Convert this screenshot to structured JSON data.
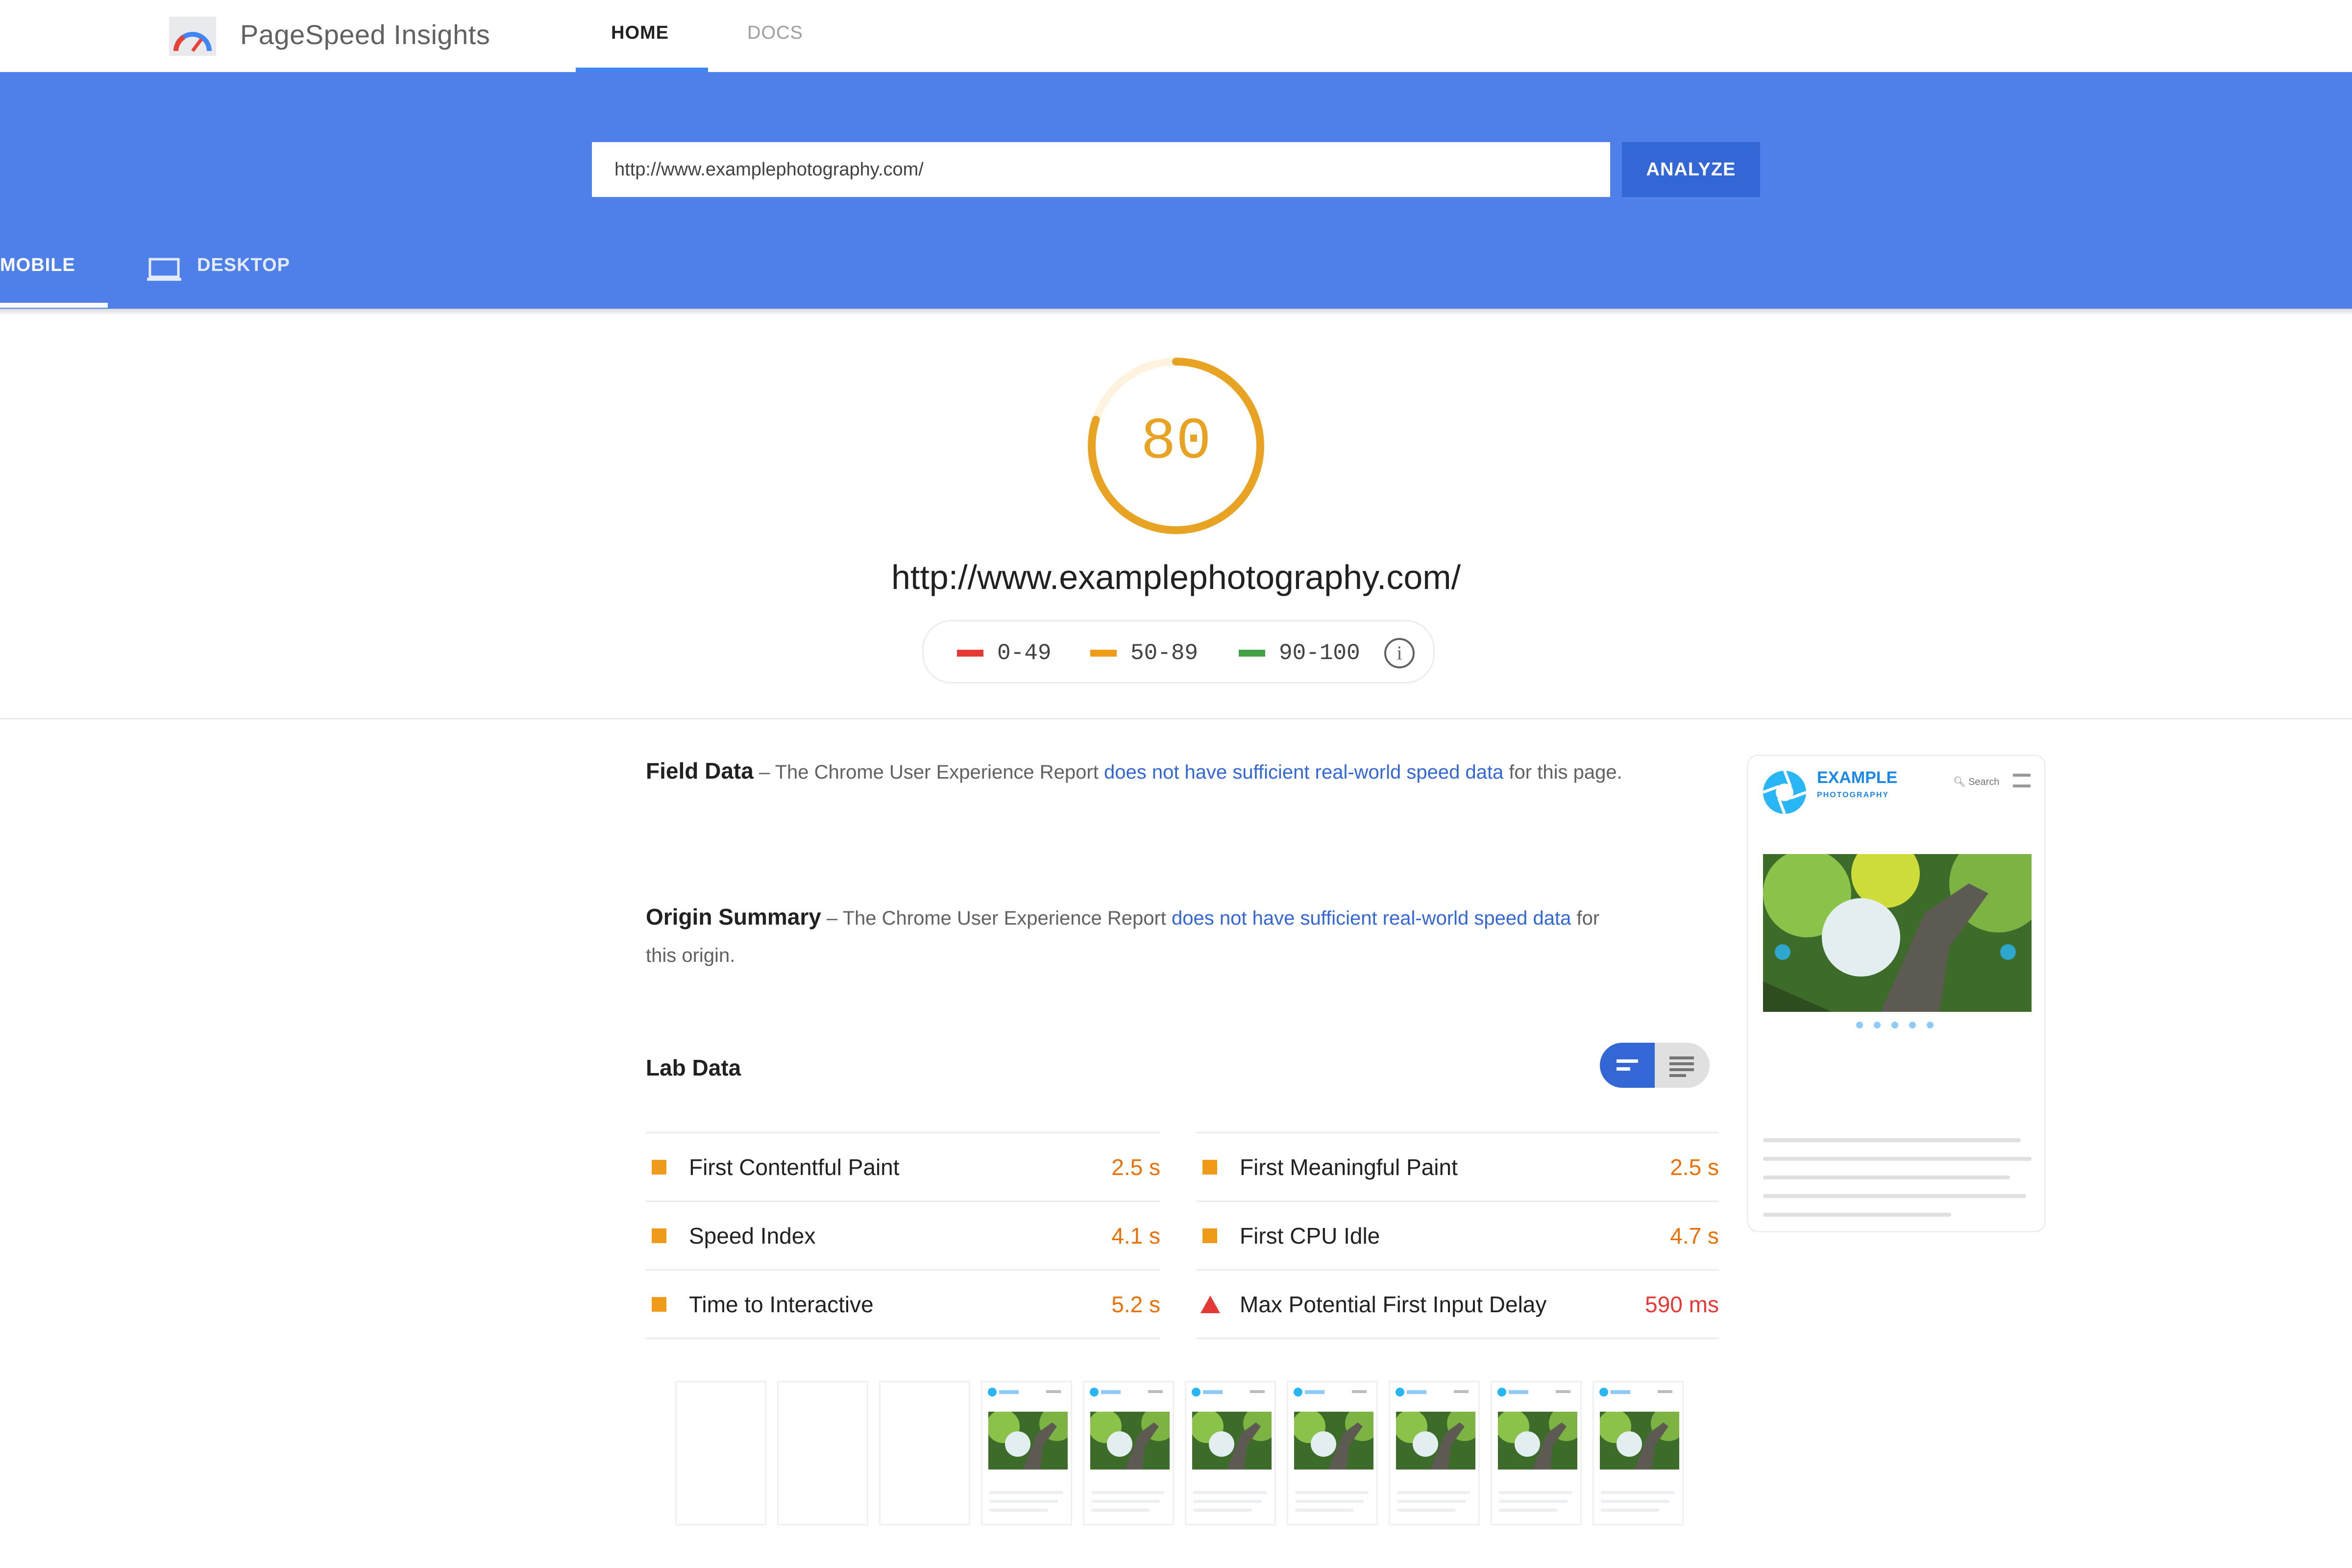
{
  "app": {
    "title": "PageSpeed Insights"
  },
  "nav": {
    "tabs": [
      {
        "label": "HOME",
        "active": true
      },
      {
        "label": "DOCS",
        "active": false
      }
    ]
  },
  "search": {
    "value": "http://www.examplephotography.com/",
    "analyze_label": "ANALYZE"
  },
  "device_tabs": [
    {
      "label": "MOBILE",
      "active": true
    },
    {
      "label": "DESKTOP",
      "active": false
    }
  ],
  "score": {
    "value": "80",
    "level_fraction": 0.8,
    "color": "#e8a323"
  },
  "page_url": "http://www.examplephotography.com/",
  "legend": [
    {
      "range": "0-49",
      "color": "#e53935"
    },
    {
      "range": "50-89",
      "color": "#ef9a19"
    },
    {
      "range": "90-100",
      "color": "#43a047"
    }
  ],
  "field_data": {
    "title": "Field Data",
    "prefix": " – The Chrome User Experience Report ",
    "link": "does not have sufficient real-world speed data",
    "suffix": " for this page."
  },
  "origin_summary": {
    "title": "Origin Summary",
    "prefix": " – The Chrome User Experience Report ",
    "link": "does not have sufficient real-world speed data",
    "suffix": " for this origin."
  },
  "lab_data": {
    "title": "Lab Data",
    "metrics": [
      {
        "label": "First Contentful Paint",
        "value": "2.5 s",
        "status": "average"
      },
      {
        "label": "First Meaningful Paint",
        "value": "2.5 s",
        "status": "average"
      },
      {
        "label": "Speed Index",
        "value": "4.1 s",
        "status": "average"
      },
      {
        "label": "First CPU Idle",
        "value": "4.7 s",
        "status": "average"
      },
      {
        "label": "Time to Interactive",
        "value": "5.2 s",
        "status": "average"
      },
      {
        "label": "Max Potential First Input Delay",
        "value": "590 ms",
        "status": "fail"
      }
    ]
  },
  "screenshot": {
    "brand": "EXAMPLE",
    "brand_sub": "PHOTOGRAPHY",
    "search_label": "Search"
  },
  "filmstrip": {
    "frames": [
      "blank",
      "blank",
      "blank",
      "loaded",
      "loaded",
      "loaded",
      "loaded",
      "loaded",
      "loaded",
      "loaded"
    ]
  }
}
